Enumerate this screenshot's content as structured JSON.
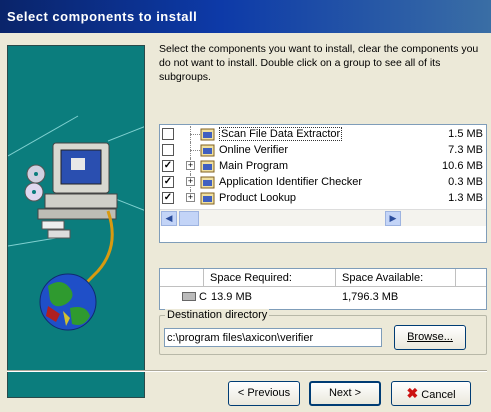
{
  "window": {
    "title": "Select components to install"
  },
  "instructions": "Select the components you want to install, clear the components you do not want to install. Double click on a group to see all of its subgroups.",
  "components": [
    {
      "label": "Scan File Data Extractor",
      "size": "1.5 MB",
      "checked": false,
      "expandable": false,
      "selected": true
    },
    {
      "label": "Online Verifier",
      "size": "7.3 MB",
      "checked": false,
      "expandable": false,
      "selected": false
    },
    {
      "label": "Main Program",
      "size": "10.6 MB",
      "checked": true,
      "expandable": true,
      "selected": false
    },
    {
      "label": "Application Identifier Checker",
      "size": "0.3 MB",
      "checked": true,
      "expandable": true,
      "selected": false
    },
    {
      "label": "Product Lookup",
      "size": "1.3 MB",
      "checked": true,
      "expandable": true,
      "selected": false
    }
  ],
  "space": {
    "required_header": "Space Required:",
    "available_header": "Space Available:",
    "drive": "C",
    "required": "13.9 MB",
    "available": "1,796.3 MB"
  },
  "destination": {
    "label": "Destination directory",
    "path": "c:\\program files\\axicon\\verifier",
    "browse_label": "Browse..."
  },
  "buttons": {
    "previous": "< Previous",
    "next": "Next >",
    "cancel": "Cancel"
  },
  "colors": {
    "title_bar": "#0a246a",
    "side_panel": "#0b7d7d",
    "cancel_x": "#cc1111"
  }
}
